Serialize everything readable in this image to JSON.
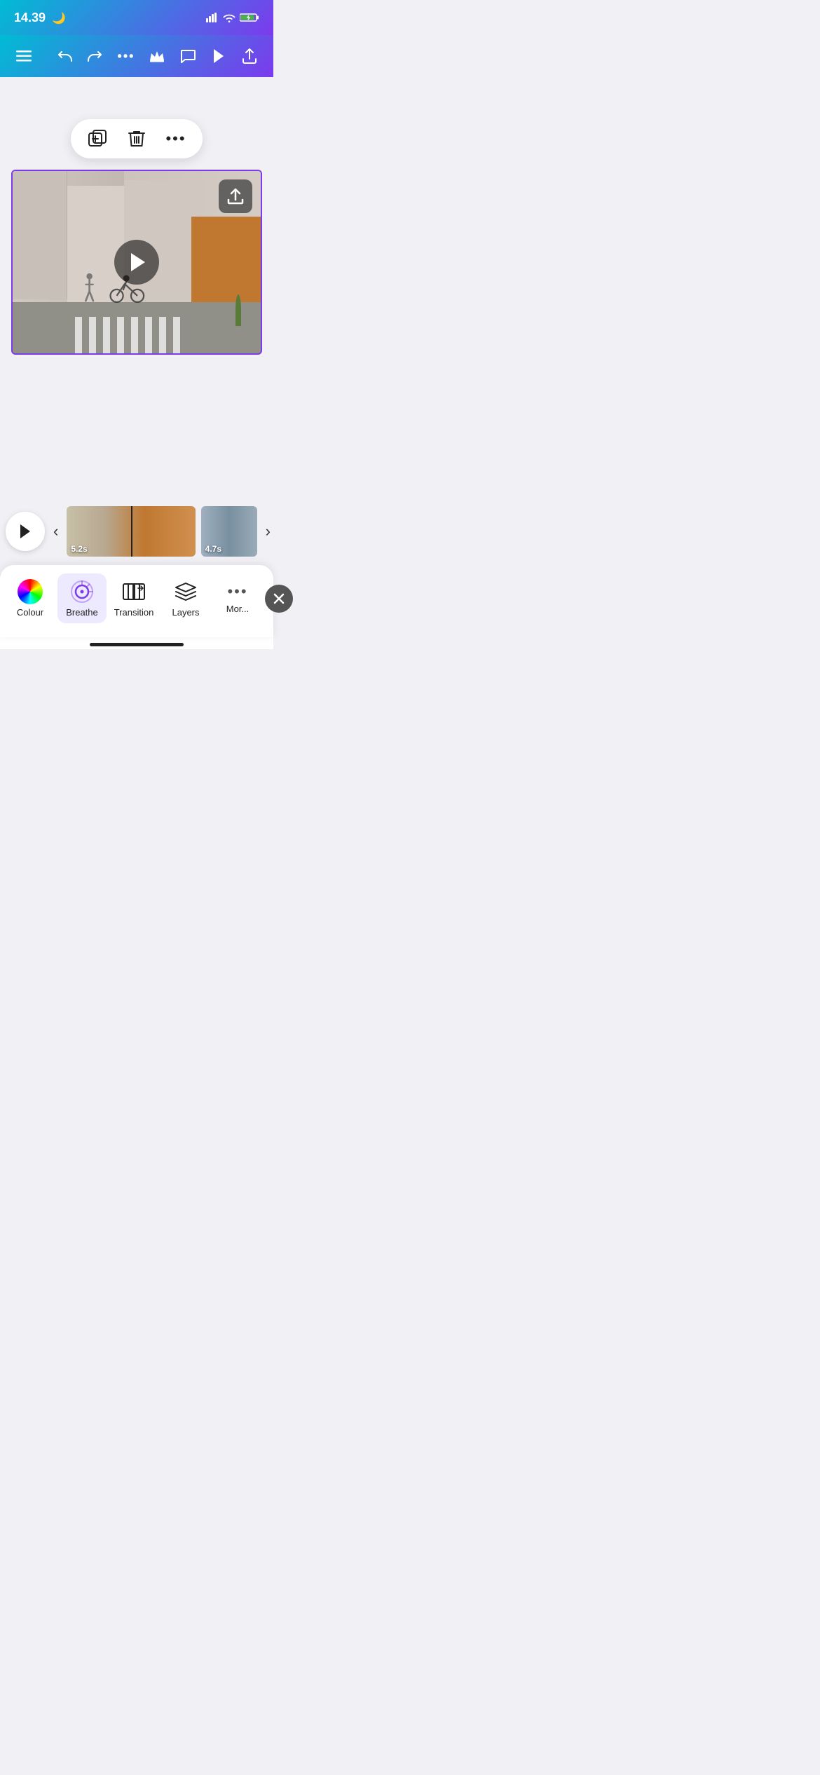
{
  "statusBar": {
    "time": "14.39",
    "moonIcon": "🌙"
  },
  "toolbar": {
    "menuLabel": "☰",
    "undoLabel": "↺",
    "redoLabel": "↻",
    "moreLabel": "•••",
    "crownLabel": "♛",
    "commentLabel": "💬",
    "playLabel": "▶",
    "shareLabel": "↑"
  },
  "floatToolbar": {
    "duplicateLabel": "duplicate",
    "deleteLabel": "delete",
    "moreLabel": "more"
  },
  "video": {
    "duration1": "5.2s",
    "duration2": "4.7s"
  },
  "bottomTools": {
    "colour": "Colour",
    "breathe": "Breathe",
    "transition": "Transition",
    "layers": "Layers",
    "more": "Mor..."
  }
}
